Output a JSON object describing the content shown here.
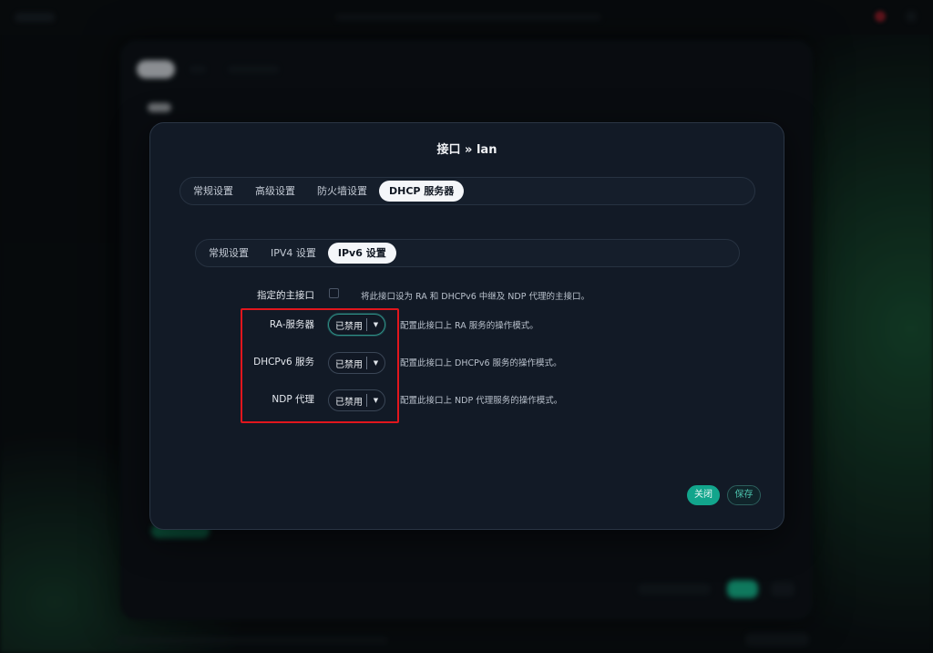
{
  "dialog": {
    "title": "接口 » lan",
    "tabs": [
      "常规设置",
      "高级设置",
      "防火墙设置",
      "DHCP 服务器"
    ],
    "active_tab": "DHCP 服务器",
    "subtabs": [
      "常规设置",
      "IPV4 设置",
      "IPv6 设置"
    ],
    "active_subtab": "IPv6 设置",
    "fields": {
      "master": {
        "label": "指定的主接口",
        "checked": false,
        "help": "将此接口设为 RA 和 DHCPv6 中继及 NDP 代理的主接口。"
      },
      "ra": {
        "label": "RA-服务器",
        "value": "已禁用",
        "help": "配置此接口上 RA 服务的操作模式。"
      },
      "dhcpv6": {
        "label": "DHCPv6 服务",
        "value": "已禁用",
        "help": "配置此接口上 DHCPv6 服务的操作模式。"
      },
      "ndp": {
        "label": "NDP 代理",
        "value": "已禁用",
        "help": "配置此接口上 NDP 代理服务的操作模式。"
      }
    },
    "buttons": {
      "close": "关闭",
      "save": "保存"
    }
  },
  "colors": {
    "accent": "#12a58c",
    "highlight": "#e1161d",
    "modal_bg": "#121a26"
  },
  "icons": {
    "select_arrow": "caret-down-icon"
  }
}
